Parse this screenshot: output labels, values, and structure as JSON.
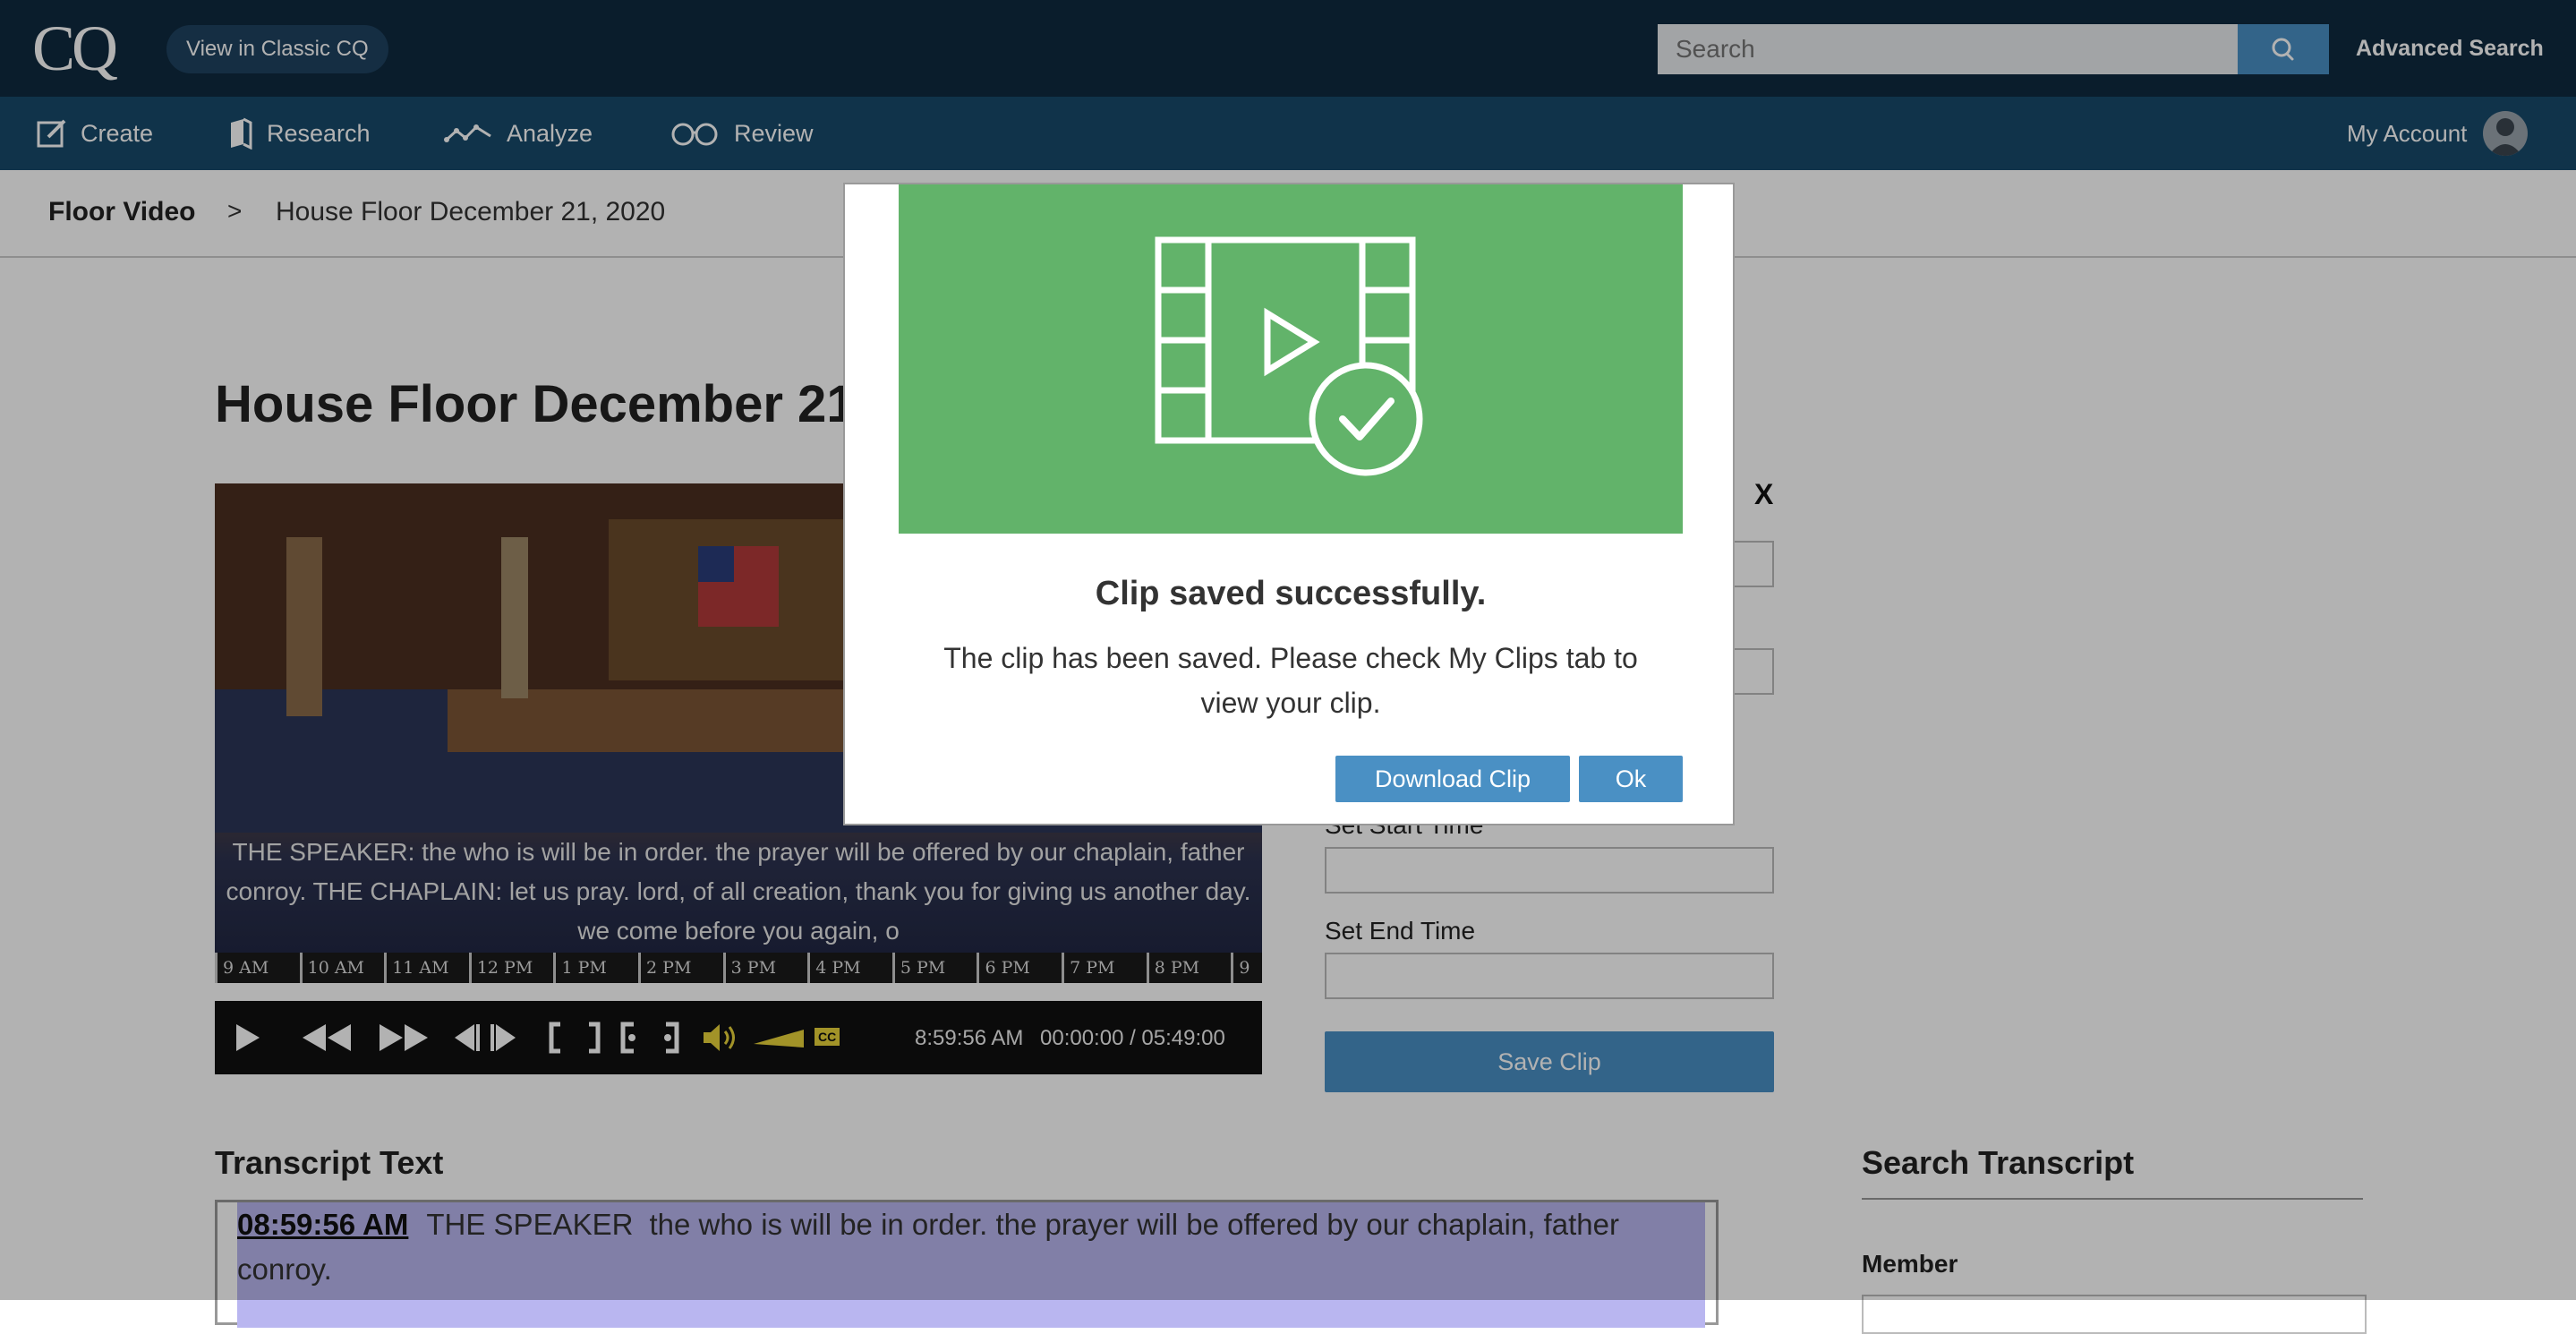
{
  "header": {
    "logo": "CQ",
    "classic_button": "View in Classic CQ",
    "search": {
      "placeholder": "Search"
    },
    "advanced_search": "Advanced Search"
  },
  "nav": {
    "items": [
      {
        "label": "Create",
        "icon": "pencil-square-icon"
      },
      {
        "label": "Research",
        "icon": "book-icon"
      },
      {
        "label": "Analyze",
        "icon": "line-trend-icon"
      },
      {
        "label": "Review",
        "icon": "glasses-icon"
      }
    ],
    "my_account": "My Account"
  },
  "breadcrumb": {
    "root": "Floor Video",
    "separator": ">",
    "current": "House Floor December 21, 2020"
  },
  "page": {
    "title": "House Floor December 21"
  },
  "video": {
    "caption": "THE SPEAKER: the who is will be in order. the prayer will be offered by our chaplain, father conroy. THE CHAPLAIN: let us pray. lord, of all creation, thank you for giving us another day. we come before you again, o",
    "timeline_ticks": [
      "9 AM",
      "10 AM",
      "11 AM",
      "12 PM",
      "1 PM",
      "2 PM",
      "3 PM",
      "4 PM",
      "5 PM",
      "6 PM",
      "7 PM",
      "8 PM",
      "9"
    ],
    "clock_time": "8:59:56 AM",
    "position": "00:00:00 / 05:49:00",
    "cc_label": "CC"
  },
  "clip_panel": {
    "close_label": "X",
    "partial_label": "Set Start Time",
    "end_label": "Set End Time",
    "save_button": "Save Clip"
  },
  "transcript": {
    "title": "Transcript Text",
    "timestamp": "08:59:56 AM",
    "speaker": "THE SPEAKER",
    "text": "the who is will be in order. the prayer will be offered by our chaplain, father conroy."
  },
  "search_transcript": {
    "title": "Search Transcript",
    "member_label": "Member"
  },
  "modal": {
    "title": "Clip saved successfully.",
    "body": "The clip has been saved. Please check My Clips tab to view your clip.",
    "download_button": "Download Clip",
    "ok_button": "Ok",
    "banner_color": "#62b36a",
    "banner_icon": "video-saved-check-icon"
  },
  "colors": {
    "topbar": "#0f2a40",
    "navbar": "#174a6b",
    "accent": "#4a90c4",
    "transcript_highlight": "#b9b6f0"
  }
}
